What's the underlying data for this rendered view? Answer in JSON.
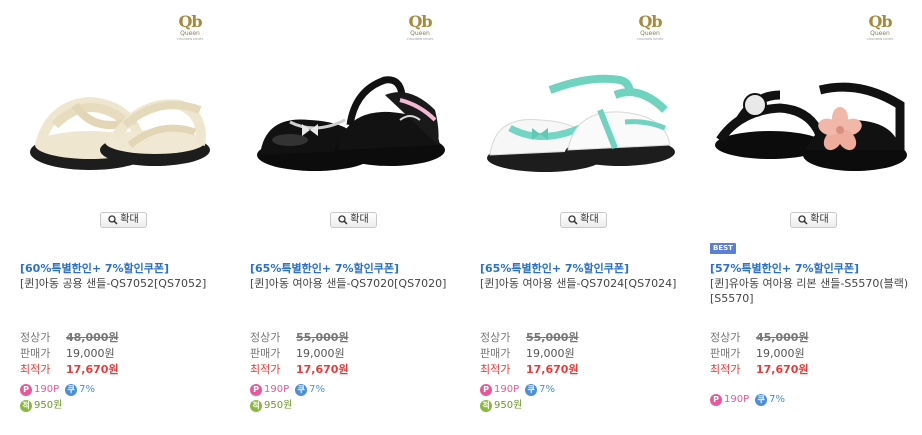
{
  "brand": {
    "mark": "Qb",
    "name": "Queen",
    "sub": "CHILDREN SHOES"
  },
  "zoom_label": "확대",
  "price_labels": {
    "regular": "정상가",
    "sale": "판매가",
    "lowest": "최적가"
  },
  "icons": {
    "point": "P",
    "coupon": "쿠",
    "save": "적"
  },
  "colors": {
    "promo": "#2a71c9",
    "final": "#e43b3b",
    "point": "#e6599b",
    "coupon": "#4a8fd8",
    "save": "#8cb83d"
  },
  "products": [
    {
      "badge": "",
      "promo": "[60%특별한인+ 7%할인쿠폰]",
      "name": "[퀸]아동 공용 샌들-QS7052[QS7052]",
      "regular": "48,000원",
      "sale": "19,000원",
      "final": "17,670원",
      "point": "190P",
      "coupon": "7%",
      "save": "950원",
      "shoe_style": "cream"
    },
    {
      "badge": "",
      "promo": "[65%특별한인+ 7%할인쿠폰]",
      "name": "[퀸]아동 여아용 샌들-QS7020[QS7020]",
      "regular": "55,000원",
      "sale": "19,000원",
      "final": "17,670원",
      "point": "190P",
      "coupon": "7%",
      "save": "950원",
      "shoe_style": "black-bow"
    },
    {
      "badge": "",
      "promo": "[65%특별한인+ 7%할인쿠폰]",
      "name": "[퀸]아동 여아용 샌들-QS7024[QS7024]",
      "regular": "55,000원",
      "sale": "19,000원",
      "final": "17,670원",
      "point": "190P",
      "coupon": "7%",
      "save": "950원",
      "shoe_style": "white-mint"
    },
    {
      "badge": "BEST",
      "promo": "[57%특별한인+ 7%할인쿠폰]",
      "name": "[퀸]유아동 여아용 리본 샌들-S5570(블랙)[S5570]",
      "regular": "45,000원",
      "sale": "19,000원",
      "final": "17,670원",
      "point": "190P",
      "coupon": "7%",
      "save": "",
      "shoe_style": "black-flower"
    }
  ]
}
